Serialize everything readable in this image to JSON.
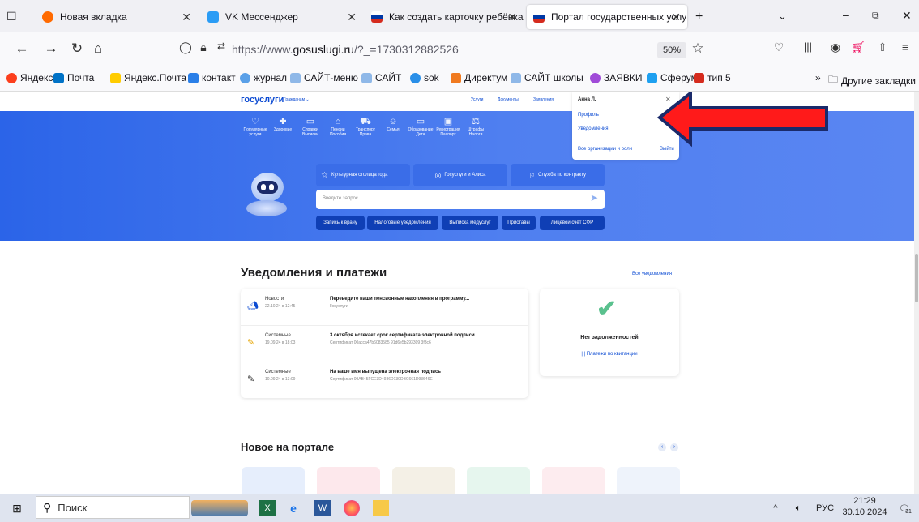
{
  "tabs": [
    {
      "label": "Новая вкладка",
      "color": "#ff6a00"
    },
    {
      "label": "VK Мессенджер",
      "color": "#2a9cf5"
    },
    {
      "label": "Как создать карточку ребёнка",
      "color": "#d52b1e"
    },
    {
      "label": "Портал государственных услуг",
      "color": "#0d4cd3"
    }
  ],
  "address": {
    "prefix": "https://www.",
    "domain": "gosuslugi.ru",
    "suffix": "/?_=1730312882526",
    "zoom": "50%"
  },
  "bookmarks": [
    "Яндекс",
    "Почта",
    "Яндекс.Почта",
    "контакт",
    "журнал",
    "САЙТ-меню",
    "САЙТ",
    "sok",
    "Директум",
    "САЙТ школы",
    "ЗАЯВКИ",
    "Сферум",
    "тип 5"
  ],
  "other_bookmarks": "Другие закладки",
  "site": {
    "logo": "госуслуги",
    "audience": "Гражданам ⌄",
    "top_links": [
      "Услуги",
      "Документы",
      "Заявления"
    ],
    "categories": [
      {
        "icon": "♡",
        "label": "Популярные услуги"
      },
      {
        "icon": "✚",
        "label": "Здоровье"
      },
      {
        "icon": "▭",
        "label": "Справки Выписки"
      },
      {
        "icon": "⌂",
        "label": "Пенсии Пособия"
      },
      {
        "icon": "⛟",
        "label": "Транспорт Права"
      },
      {
        "icon": "☺",
        "label": "Семья"
      },
      {
        "icon": "▭",
        "label": "Образование Дети"
      },
      {
        "icon": "▣",
        "label": "Регистрация Паспорт"
      },
      {
        "icon": "⚖",
        "label": "Штрафы Налоги"
      }
    ],
    "promo": [
      "Культурная столица года",
      "Госуслуги и Алиса",
      "Служба по контракту"
    ],
    "search_placeholder": "Введите запрос...",
    "quick": [
      "Запись к врачу",
      "Налоговые уведомления",
      "Выписка медуслуг",
      "Приставы",
      "Лицевой счёт СФР"
    ]
  },
  "dropdown": {
    "user": "Анна Л.",
    "profile": "Профиль",
    "notifications": "Уведомления",
    "orgs": "Все организации и роли",
    "logout": "Выйти"
  },
  "notifications": {
    "title": "Уведомления и платежи",
    "all_link": "Все уведомления",
    "items": [
      {
        "type": "Новости",
        "date": "22.10.24 в 12:45",
        "title": "Переведите ваши пенсионные накопления в программу...",
        "sub": "Госуслуги"
      },
      {
        "type": "Системные",
        "date": "19.09.24 в 18:03",
        "title": "3 октября истекает срок сертификата электронной подписи",
        "sub": "Сертификат 00acca47b6083585 91d6e5b293309 3f8c6"
      },
      {
        "type": "Системные",
        "date": "10.09.24 в 13:09",
        "title": "На ваше имя выпущена электронная подпись",
        "sub": "Сертификат 09AB45FCE3D4936D130DBC661D93646E"
      }
    ],
    "debt": "Нет задолженностей",
    "receipt": "Платежи по квитанции"
  },
  "new_title": "Новое на портале",
  "taskbar": {
    "search": "Поиск",
    "lang": "РУС",
    "time": "21:29",
    "date": "30.10.2024",
    "badge": "31"
  }
}
